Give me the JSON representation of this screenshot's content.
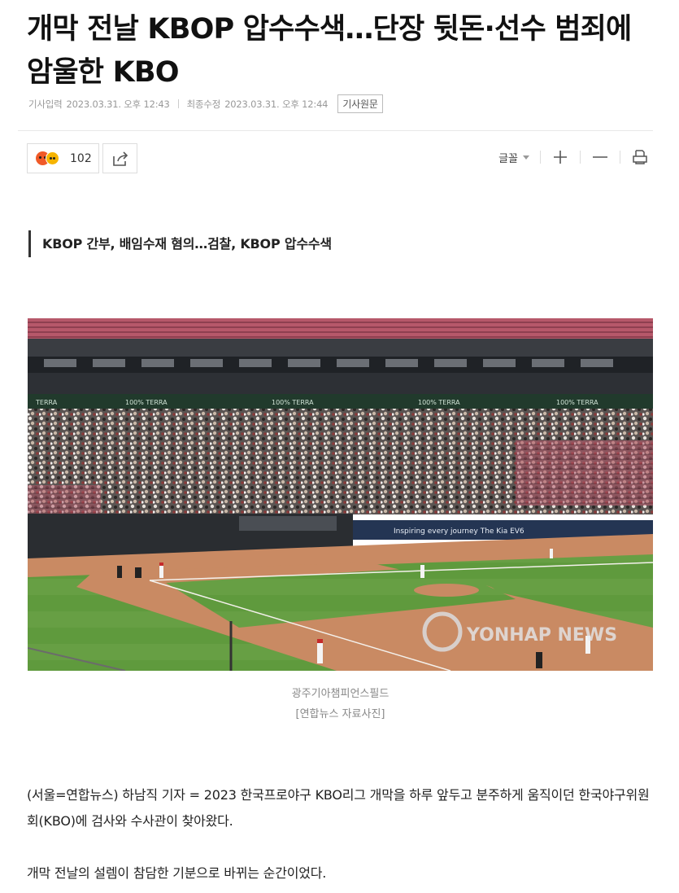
{
  "article": {
    "headline": "개막 전날 KBOP 압수수색…단장 뒷돈·선수 범죄에 암울한 KBO",
    "published_label": "기사입력",
    "published_value": "2023.03.31. 오후 12:43",
    "modified_label": "최종수정",
    "modified_value": "2023.03.31. 오후 12:44",
    "source_button": "기사원문",
    "subheading": "KBOP 간부, 배임수재 혐의…검찰, KBOP 압수수색",
    "photo": {
      "caption_line1": "광주기아챔피언스필드",
      "caption_line2": "[연합뉴스 자료사진]",
      "watermark": "YONHAP NEWS",
      "signage_terra": "TERRA",
      "signage_ads": "100% TERRA",
      "signage_kia": "Inspiring every journey  The Kia EV6"
    },
    "paragraphs": [
      "(서울=연합뉴스) 하남직 기자 = 2023 한국프로야구 KBO리그 개막을 하루 앞두고 분주하게 움직이던 한국야구위원회(KBO)에 검사와 수사관이 찾아왔다.",
      "개막 전날의 설렘이 참담한 기분으로 바뀌는 순간이었다."
    ]
  },
  "toolbar": {
    "reaction_count": "102",
    "font_label": "글꼴"
  },
  "icons": {
    "reaction": [
      "angry-emoji-icon",
      "laugh-emoji-icon"
    ],
    "share": "share-icon",
    "font_caret": "caret-down-icon",
    "zoom_in": "plus-icon",
    "zoom_out": "minus-icon",
    "print": "print-icon"
  },
  "colors": {
    "field_green": "#5f9a3d",
    "infield_dirt": "#c98a63",
    "stand_dark": "#3a3d42",
    "angry_emoji": "#f05a28",
    "laugh_emoji": "#f6b400"
  }
}
